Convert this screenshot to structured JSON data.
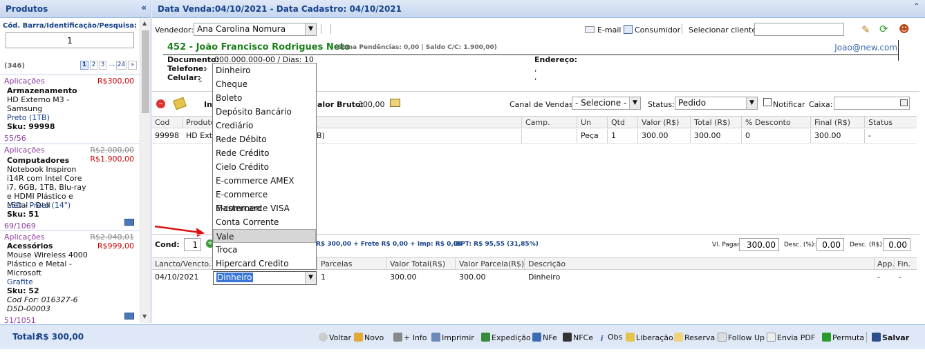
{
  "left": {
    "title": "Produtos",
    "search_label": "Cód. Barra/Identificação/Pesquisa:",
    "search_value": "1",
    "count": "(346)",
    "pages": [
      "1",
      "2",
      "3",
      "...",
      "24",
      "»"
    ],
    "products": [
      {
        "category": "Aplicações",
        "price": "R$300,00",
        "name": "Armazenamento",
        "desc": "HD Externo M3 - Samsung",
        "variant": "Preto (1TB)",
        "sku": "Sku: 99998",
        "stock": "55/56"
      },
      {
        "category": "Aplicações",
        "old_price": "R$2.000,00",
        "price": "R$1.900,00",
        "name": "Computadores",
        "desc": "Notebook Inspiron i14R com Intel Core i7, 6GB, 1TB, Blu-ray e HDMI Plástico e Metal - Dell",
        "variant": "LED - Preto (14\")",
        "sku": "Sku: 51",
        "stock": "69/1069"
      },
      {
        "category": "Aplicações",
        "old_price": "R$2.040,01",
        "price": "R$999,00",
        "name": "Acessórios",
        "desc": "Mouse Wireless 4000 Plástico e Metal - Microsoft",
        "variant": "Grafite",
        "sku": "Sku: 52",
        "cod_for": "Cod For: 016327-6 D5D-00003",
        "stock": "51/1051"
      }
    ],
    "total_label": "Total:",
    "total_value": "R$ 300,00"
  },
  "header": {
    "title": "Data Venda:04/10/2021 - Data Cadastro: 04/10/2021"
  },
  "seller": {
    "label": "Vendedor:",
    "value": "Ana Carolina Nomura"
  },
  "toolbar_top": {
    "email": "E-mail",
    "consumer": "Consumidor",
    "select_client": "Selecionar cliente:"
  },
  "client": {
    "title": "452 - João Francisco Rodrigues Neto",
    "balance": "(Soma Pendências: 0,00 | Saldo C/C: 1.900,00)",
    "email": "Joao@new.com",
    "doc_label": "Documento:",
    "doc_value": "000.000.000-00 / Dias: 10",
    "phone_label": "Telefone:",
    "phone_value": "-",
    "cell_label": "Celular:",
    "cell_value": "-",
    "address_label": "Endereço:",
    "address_l1": ",",
    "address_l2": ","
  },
  "items_bar": {
    "info_label": "In",
    "gross_label": "alor Bruto:",
    "gross_value": "300,00",
    "channel_label": "Canal de Vendas:",
    "channel_value": "- Selecione -",
    "status_label": "Status:",
    "status_value": "Pedido",
    "notify_label": "Notificar",
    "cash_label": "Caixa:"
  },
  "items_grid": {
    "headers": [
      "Cod",
      "Produto",
      "Camp.",
      "Un",
      "Qtd",
      "Valor (R$)",
      "Total (R$)",
      "% Desconto",
      "Final (R$)",
      "Status"
    ],
    "rows": [
      {
        "cod": "99998",
        "product": "HD Exte",
        "product_tail": "B)",
        "camp": "",
        "un": "Peça",
        "qtd": "1",
        "valor": "300.00",
        "total": "300.00",
        "desconto": "0",
        "final": "300.00",
        "status": "-"
      }
    ]
  },
  "cond_bar": {
    "cond_label": "Cond:",
    "cond_value": "1",
    "summary": "R$ 300,00 + Frete R$ 0,00 + Imp: R$ 0,00",
    "ibpt": "IBPT: R$ 95,55 (31,85%)",
    "pay_label": "Vl. Pagar:",
    "pay_value": "300.00",
    "disc_pct_label": "Desc. (%):",
    "disc_pct_value": "0.00",
    "disc_val_label": "Desc. (R$):",
    "disc_val_value": "0.00"
  },
  "pay_grid": {
    "headers": [
      "Lancto/Vencto.",
      "Parcelas",
      "Valor Total(R$)",
      "Valor Parcela(R$)",
      "Descrição",
      "App.",
      "Fin."
    ],
    "rows": [
      {
        "date": "04/10/2021",
        "method": "Dinheiro",
        "parcelas": "1",
        "total": "300.00",
        "parcela": "300.00",
        "desc": "Dinheiro",
        "app": "-",
        "fin": "-"
      }
    ]
  },
  "dropdown_options": [
    "Dinheiro",
    "Cheque",
    "Boleto",
    "Depósito Bancário",
    "Crediário",
    "Rede Débito",
    "Rede Crédito",
    "Cielo Crédito",
    "E-commerce AMEX",
    "E-commerce Mastercard",
    "E-commerce VISA",
    "Conta Corrente",
    "Vale",
    "Troca",
    "Hipercard Credito"
  ],
  "footer": {
    "buttons": [
      "Voltar",
      "Novo",
      "+ Info",
      "Imprimir",
      "Expedição",
      "NFe",
      "NFCe",
      "Obs",
      "Liberação",
      "Reserva",
      "Follow Up",
      "Envia PDF",
      "Permuta",
      "Salvar"
    ]
  },
  "colors": {
    "accent": "#15428b",
    "client_green": "#1a7f1a",
    "panel": "#dfe8f6"
  }
}
